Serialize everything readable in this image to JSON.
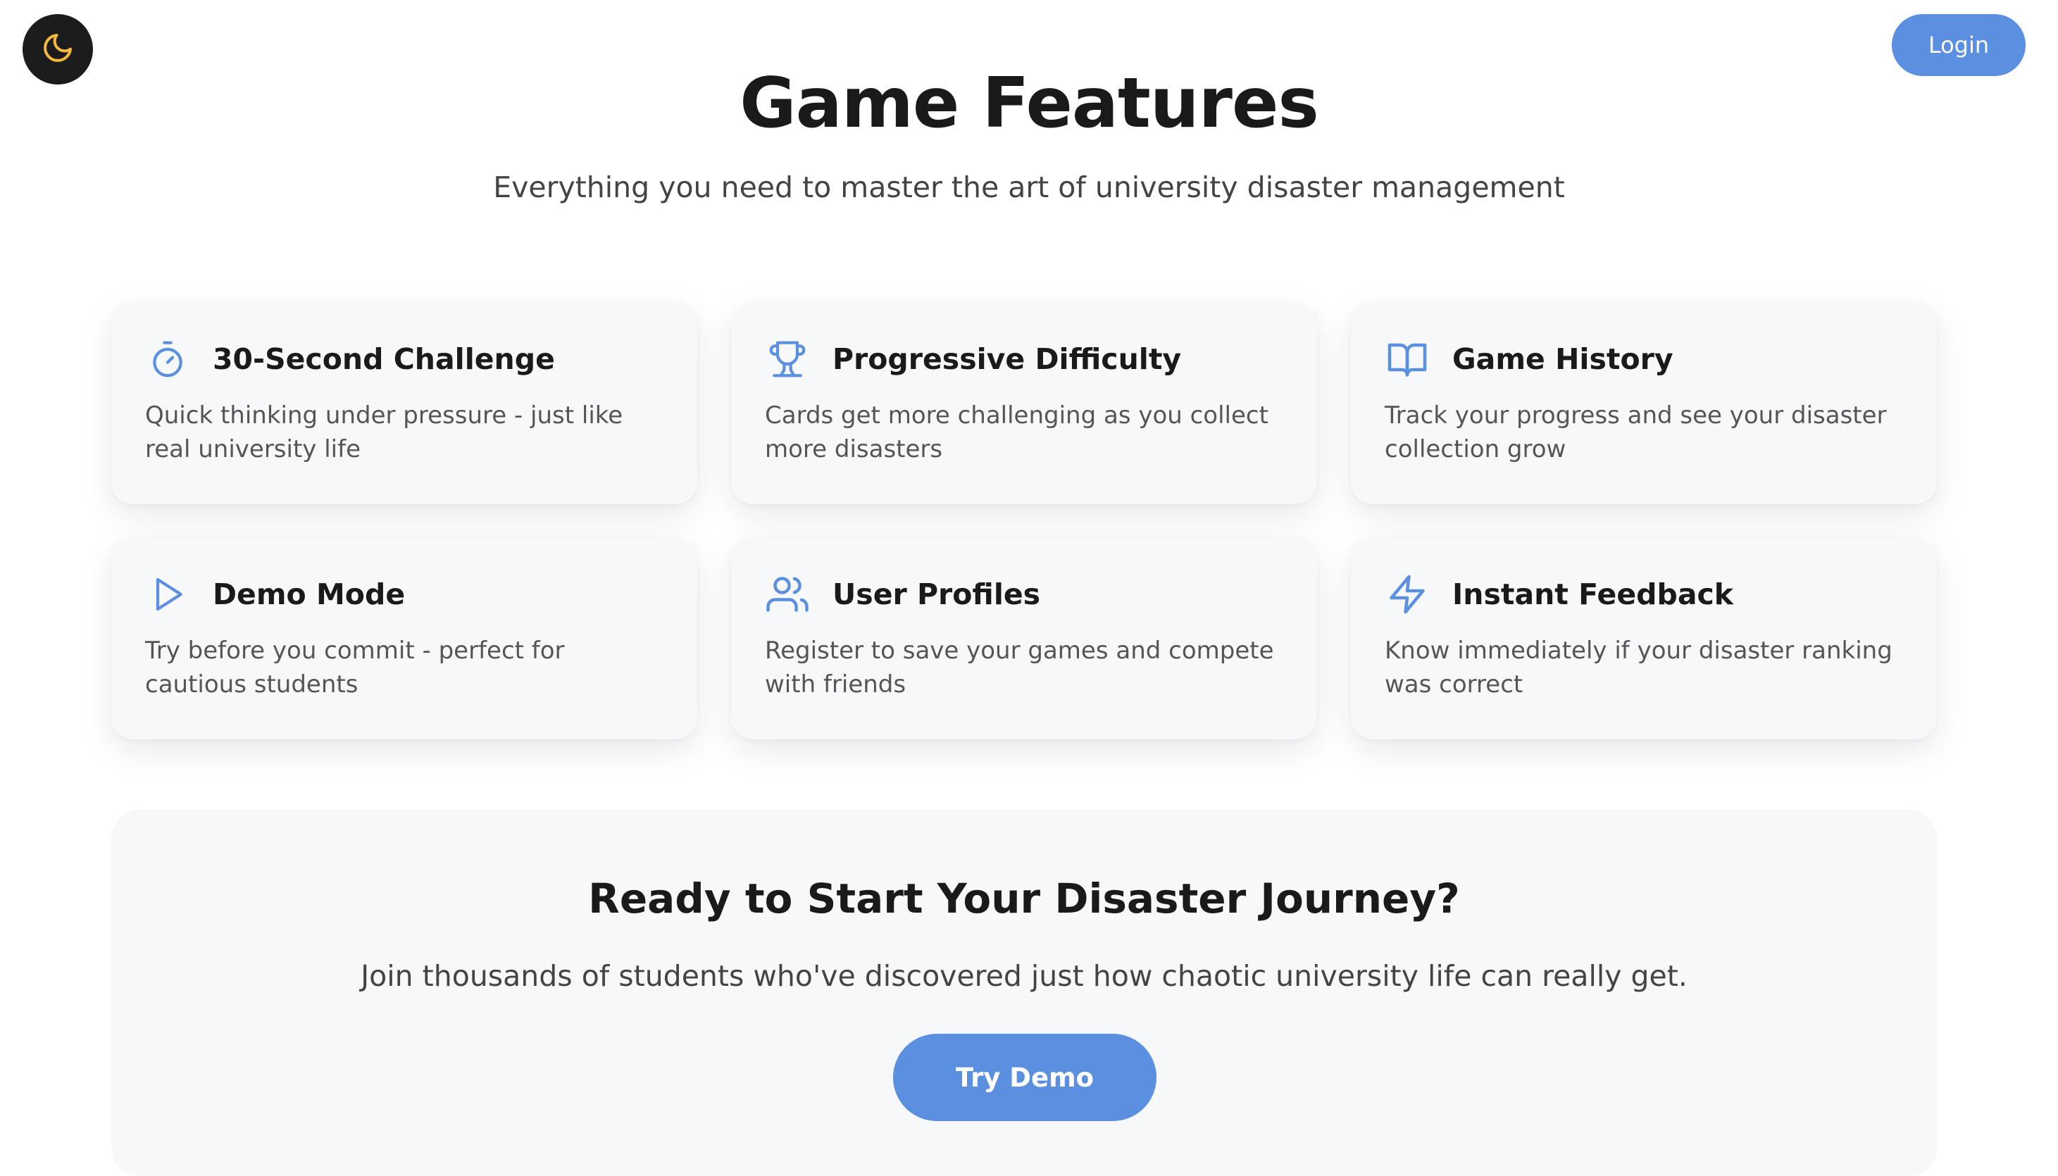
{
  "header": {
    "theme_icon": "moon-icon",
    "login_label": "Login"
  },
  "hero": {
    "title": "Game Features",
    "subtitle": "Everything you need to master the art of university disaster management"
  },
  "features": [
    {
      "icon": "stopwatch-icon",
      "title": "30-Second Challenge",
      "description": "Quick thinking under pressure - just like real university life"
    },
    {
      "icon": "trophy-icon",
      "title": "Progressive Difficulty",
      "description": "Cards get more challenging as you collect more disasters"
    },
    {
      "icon": "book-open-icon",
      "title": "Game History",
      "description": "Track your progress and see your disaster collection grow"
    },
    {
      "icon": "play-icon",
      "title": "Demo Mode",
      "description": "Try before you commit - perfect for cautious students"
    },
    {
      "icon": "users-icon",
      "title": "User Profiles",
      "description": "Register to save your games and compete with friends"
    },
    {
      "icon": "lightning-icon",
      "title": "Instant Feedback",
      "description": "Know immediately if your disaster ranking was correct"
    }
  ],
  "cta": {
    "title": "Ready to Start Your Disaster Journey?",
    "text": "Join thousands of students who've discovered just how chaotic university life can really get.",
    "button_label": "Try Demo"
  },
  "colors": {
    "accent": "#5b8fdf",
    "moon": "#f5b83d",
    "toggle_bg": "#1c1c1c"
  }
}
